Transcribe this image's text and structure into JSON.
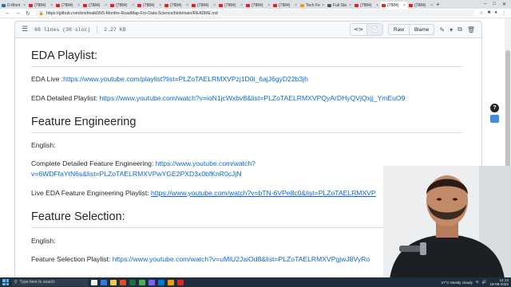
{
  "browser": {
    "tabs": [
      {
        "label": "D-Mont",
        "color": "#2b6cb0",
        "active": false
      },
      {
        "label": "(7884)",
        "color": "#e62117",
        "active": false
      },
      {
        "label": "(7884)",
        "color": "#e62117",
        "active": false
      },
      {
        "label": "(7884)",
        "color": "#e62117",
        "active": false
      },
      {
        "label": "(7884)",
        "color": "#e62117",
        "active": false
      },
      {
        "label": "(7884)",
        "color": "#e62117",
        "active": false
      },
      {
        "label": "(7884)",
        "color": "#e62117",
        "active": false
      },
      {
        "label": "(7884)",
        "color": "#e62117",
        "active": false
      },
      {
        "label": "(7884)",
        "color": "#e62117",
        "active": false
      },
      {
        "label": "(7884)",
        "color": "#e62117",
        "active": false
      },
      {
        "label": "(7884)",
        "color": "#e62117",
        "active": false
      },
      {
        "label": "Tech Fe",
        "color": "#f59e0b",
        "active": false
      },
      {
        "label": "Full Sta",
        "color": "#4a5568",
        "active": false
      },
      {
        "label": "(7884)",
        "color": "#e62117",
        "active": false
      },
      {
        "label": "(7884)",
        "color": "#e62117",
        "active": true
      },
      {
        "label": "(7884)",
        "color": "#e62117",
        "active": false
      }
    ],
    "url": "https://github.com/krishnaik06/5-Months-RoadMap-For-Data-Science/blob/main/README.md"
  },
  "file_header": {
    "lines": "68 lines (38 sloc)",
    "size": "2.27 KB",
    "raw_label": "Raw",
    "blame_label": "Blame"
  },
  "readme": {
    "eda": {
      "heading": "EDA Playlist:",
      "live_label": "EDA Live :",
      "live_link": "https://www.youtube.com/playlist?list=PLZoTAELRMXVPzj1D0i_6ajJ6gyD22b3jh",
      "detailed_label": "EDA Detailed Playlist: ",
      "detailed_link": "https://www.youtube.com/watch?v=ioN1jcWxbv8&list=PLZoTAELRMXVPQyArDHyQVjQxjj_YmEuO9"
    },
    "fe": {
      "heading": "Feature Engineering",
      "english": "English:",
      "complete_label": "Complete Detailed Feature Engineering: ",
      "complete_link_1": "https://www.youtube.com/watch?",
      "complete_link_2": "v=6WDFfaYtN6s&list=PLZoTAELRMXVPwYGE2PXD3x0bfKnR0cJjN",
      "live_label": "Live EDA Feature Engineering Playlist: ",
      "live_link": "https://www.youtube.com/watch?v=bTN-6VPe8c0&list=PLZoTAELRMXVP"
    },
    "fs": {
      "heading": "Feature Selection:",
      "english": "English:",
      "playlist_label": "Feature Selection Playlist: ",
      "playlist_link": "https://www.youtube.com/watch?v=uMlU2JaiOd8&list=PLZoTAELRMXVPgjwJ8VyRo"
    }
  },
  "taskbar": {
    "search_placeholder": "Type here to search",
    "weather": "27°C  Mostly cloudy",
    "time": "14:13",
    "date": "19-08-2022"
  }
}
